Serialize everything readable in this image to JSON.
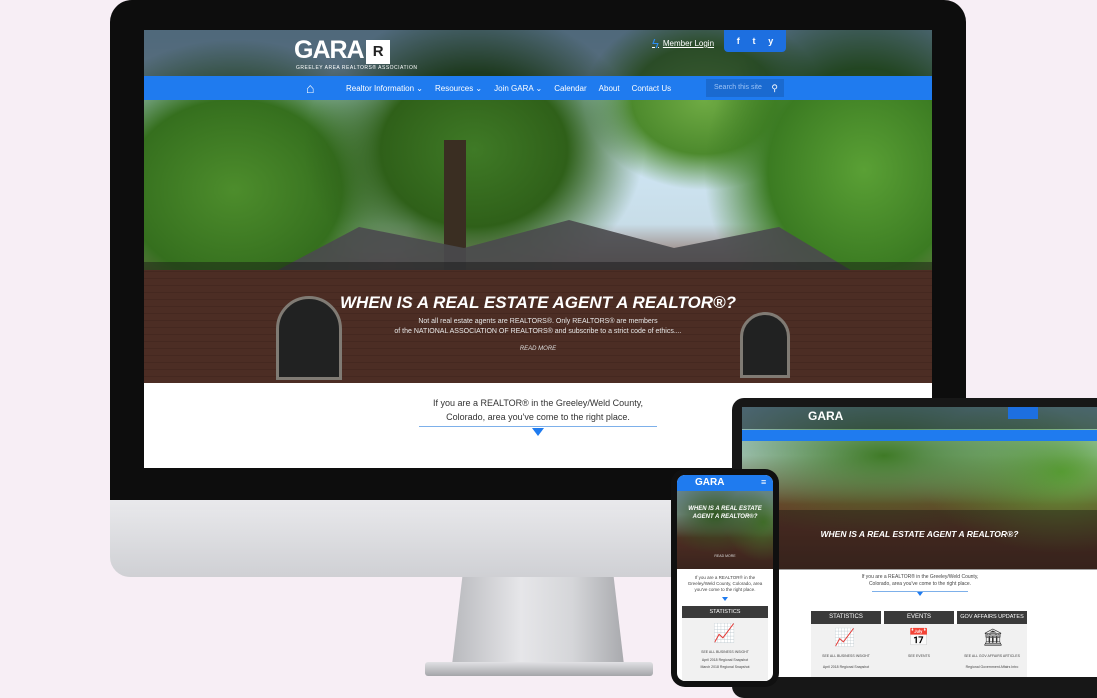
{
  "site": {
    "logo_text": "GARA",
    "logo_mark": "R",
    "logo_sub": "GREELEY AREA REALTORS® ASSOCIATION",
    "member_login": "Member Login",
    "social": [
      "f",
      "t",
      "y"
    ],
    "nav": {
      "items": [
        "Realtor Information ⌄",
        "Resources ⌄",
        "Join GARA ⌄",
        "Calendar",
        "About",
        "Contact Us"
      ],
      "search_placeholder": "Search this site"
    },
    "hero": {
      "headline": "WHEN IS A REAL ESTATE AGENT A REALTOR®?",
      "text_line1": "Not all real estate agents are REALTORS®. Only REALTORS® are members",
      "text_line2": "of the NATIONAL ASSOCIATION OF REALTORS® and subscribe to a strict code of ethics....",
      "read_more": "READ MORE"
    },
    "intro_line1": "If you are a REALTOR® in the Greeley/Weld County,",
    "intro_line2": "Colorado, area you've come to the right place."
  },
  "tablet": {
    "headline": "WHEN IS A REAL ESTATE AGENT A REALTOR®?",
    "intro": "If you are a REALTOR® in the Greeley/Weld County, Colorado, area you've come to the right place.",
    "panels": [
      {
        "title": "STATISTICS",
        "icon": "chart-up-icon",
        "caption": "SEE ALL BUSINESS INSIGHT",
        "sub": "April 2018 Regional Snapshot"
      },
      {
        "title": "EVENTS",
        "icon": "calendar-star-icon",
        "caption": "SEE EVENTS",
        "sub": ""
      },
      {
        "title": "GOV AFFAIRS UPDATES",
        "icon": "capitol-icon",
        "caption": "SEE ALL GOV AFFAIRS ARTICLES",
        "sub": "Regional Government Affairs Intro"
      }
    ]
  },
  "phone": {
    "headline": "WHEN IS A REAL ESTATE AGENT A REALTOR®?",
    "read_more": "READ MORE",
    "intro": "If you are a REALTOR® in the Greeley/Weld County, Colorado, area you've come to the right place.",
    "panel_title": "STATISTICS",
    "caption": "SEE ALL BUSINESS INSIGHT",
    "sub1": "April 2018 Regional Snapshot",
    "sub2": "March 2018 Regional Snapshot"
  },
  "colors": {
    "nav_blue": "#1f7bef",
    "background": "#f7eef5",
    "panel_dark": "#3a3a3a"
  }
}
